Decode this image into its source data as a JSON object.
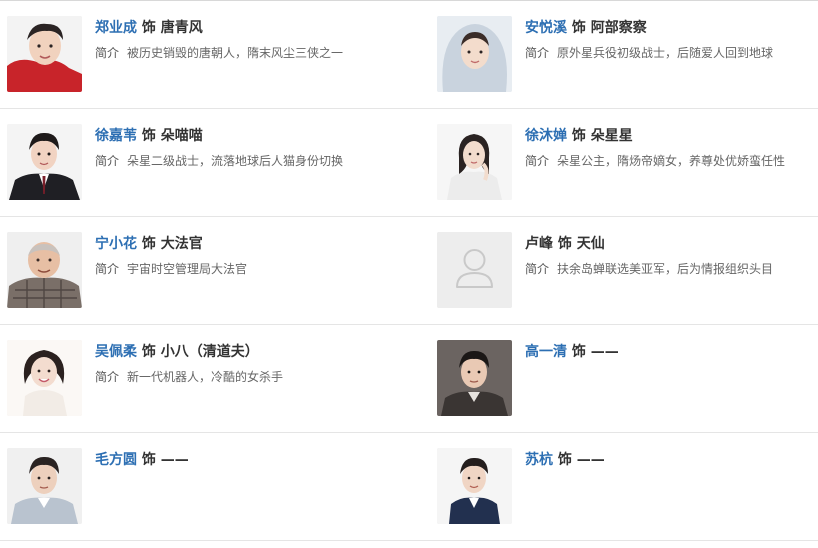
{
  "cast": [
    {
      "actor": "郑业成",
      "as_word": "饰",
      "role": "唐青风",
      "bio_label": "简介",
      "bio": "被历史销毁的唐朝人，隋末风尘三侠之一",
      "photo": "portrait-man-red",
      "accent": "#c8242a"
    },
    {
      "actor": "安悦溪",
      "as_word": "饰",
      "role": "阿部察察",
      "bio_label": "简介",
      "bio": "原外星兵役初级战士，后随爱人回到地球",
      "photo": "portrait-woman-hood",
      "accent": "#b9c6d6"
    },
    {
      "actor": "徐嘉苇",
      "as_word": "饰",
      "role": "朵喵喵",
      "bio_label": "简介",
      "bio": "朵星二级战士，流落地球后人猫身份切换",
      "photo": "portrait-man-suit",
      "accent": "#1f1f24"
    },
    {
      "actor": "徐沐婵",
      "as_word": "饰",
      "role": "朵星星",
      "bio_label": "简介",
      "bio": "朵星公主，隋炀帝嫡女，养尊处优娇蛮任性",
      "photo": "portrait-woman-white",
      "accent": "#e9e9e9"
    },
    {
      "actor": "宁小花",
      "as_word": "饰",
      "role": "大法官",
      "bio_label": "简介",
      "bio": "宇宙时空管理局大法官",
      "photo": "portrait-old-man-plaid",
      "accent": "#7a6f68"
    },
    {
      "actor": "卢峰",
      "as_word": "饰",
      "role": "天仙",
      "bio_label": "简介",
      "bio": "扶余岛蝉联选美亚军，后为情报组织头目",
      "photo": "placeholder-person",
      "accent": "#d4d4d4"
    },
    {
      "actor": "吴佩柔",
      "as_word": "饰",
      "role": "小八（清道夫）",
      "bio_label": "简介",
      "bio": "新一代机器人，冷酷的女杀手",
      "photo": "portrait-woman-smile",
      "accent": "#f2ece6"
    },
    {
      "actor": "高一清",
      "as_word": "饰",
      "role": "——",
      "bio_label": "",
      "bio": "",
      "photo": "portrait-man-dark",
      "accent": "#3a3533"
    },
    {
      "actor": "毛方圆",
      "as_word": "饰",
      "role": "——",
      "bio_label": "",
      "bio": "",
      "photo": "portrait-man-lightsuit",
      "accent": "#b9c3cf"
    },
    {
      "actor": "苏杭",
      "as_word": "饰",
      "role": "——",
      "bio_label": "",
      "bio": "",
      "photo": "portrait-man-navy",
      "accent": "#22304f"
    }
  ]
}
